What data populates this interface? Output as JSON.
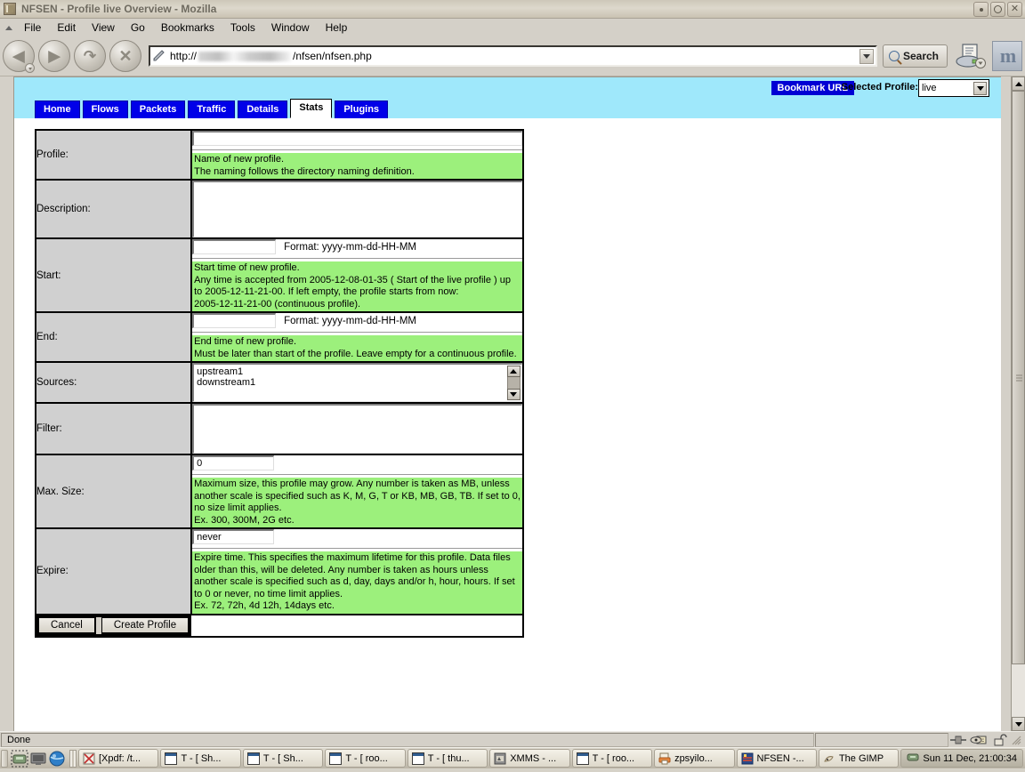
{
  "window": {
    "title": "NFSEN - Profile live Overview - Mozilla",
    "icon": "app-icon",
    "buttons": {
      "minimize": "·",
      "maximize": "○",
      "close": "×"
    }
  },
  "menubar": [
    {
      "label": "File"
    },
    {
      "label": "Edit"
    },
    {
      "label": "View"
    },
    {
      "label": "Go"
    },
    {
      "label": "Bookmarks"
    },
    {
      "label": "Tools"
    },
    {
      "label": "Window"
    },
    {
      "label": "Help"
    }
  ],
  "navbar": {
    "back": "◀",
    "forward": "▶",
    "reload": "↻",
    "stop": "✕",
    "url_prefix": "http://",
    "url_suffix": "/nfsen/nfsen.php",
    "search_label": "Search",
    "print_icon": "print-icon",
    "mozilla_icon": "m"
  },
  "nfsen": {
    "bookmark_label": "Bookmark URL",
    "selected_profile_label": "Selected Profile:",
    "selected_profile_value": "live",
    "banner_color": "#9fe8fb",
    "tab_color": "#0000e8",
    "tabs": [
      {
        "label": "Home",
        "active": false
      },
      {
        "label": "Flows",
        "active": false
      },
      {
        "label": "Packets",
        "active": false
      },
      {
        "label": "Traffic",
        "active": false
      },
      {
        "label": "Details",
        "active": false
      },
      {
        "label": "Stats",
        "active": true
      },
      {
        "label": "Plugins",
        "active": false
      }
    ]
  },
  "form": {
    "help_color": "#9cf07c",
    "profile": {
      "label": "Profile:",
      "value": "",
      "help": [
        "Name of new profile.",
        "The naming follows the directory naming definition."
      ]
    },
    "description": {
      "label": "Description:",
      "value": ""
    },
    "start": {
      "label": "Start:",
      "value": "",
      "format": "Format: yyyy-mm-dd-HH-MM",
      "help": [
        "Start time of new profile.",
        "Any time is accepted from 2005-12-08-01-35 ( Start of the live profile ) up",
        "to 2005-12-11-21-00. If left empty, the profile starts from now:",
        "2005-12-11-21-00 (continuous profile)."
      ]
    },
    "end": {
      "label": "End:",
      "value": "",
      "format": "Format: yyyy-mm-dd-HH-MM",
      "help": [
        "End time of new profile.",
        "Must be later than start of the profile. Leave empty for a continuous profile."
      ]
    },
    "sources": {
      "label": "Sources:",
      "options": [
        "upstream1",
        "downstream1"
      ]
    },
    "filter": {
      "label": "Filter:",
      "value": ""
    },
    "maxsize": {
      "label": "Max. Size:",
      "value": "0",
      "help": [
        "Maximum size, this profile may grow. Any number is taken as MB, unless",
        "another scale is specified such as K, M, G, T or KB, MB, GB, TB. If set to 0,",
        "no size limit applies.",
        "Ex. 300, 300M, 2G etc."
      ]
    },
    "expire": {
      "label": "Expire:",
      "value": "never",
      "help": [
        "Expire time. This specifies the maximum lifetime for this profile. Data files",
        "older than this, will be deleted. Any number is taken as hours unless",
        "another scale is specified such as d, day, days and/or h, hour, hours. If set",
        "to 0 or never, no time limit applies.",
        "Ex. 72, 72h, 4d 12h, 14days etc."
      ]
    },
    "cancel_label": "Cancel",
    "submit_label": "Create Profile"
  },
  "statusbar": {
    "text": "Done",
    "icons": [
      "network-activity-icon",
      "cookie-icon",
      "padlock-open-icon"
    ]
  },
  "taskbar": {
    "launchers": [
      "terminal-launcher-icon",
      "display-launcher-icon",
      "browser-launcher-icon"
    ],
    "items": [
      {
        "label": "[Xpdf: /t...",
        "icon": "xpdf-icon"
      },
      {
        "label": "T - [ Sh...",
        "icon": "terminal-icon"
      },
      {
        "label": "T - [ Sh...",
        "icon": "terminal-icon"
      },
      {
        "label": "T - [ roo...",
        "icon": "terminal-icon"
      },
      {
        "label": "T - [ thu...",
        "icon": "terminal-icon"
      },
      {
        "label": "XMMS - ...",
        "icon": "xmms-icon"
      },
      {
        "label": "T - [ roo...",
        "icon": "terminal-icon"
      },
      {
        "label": "zpsyilo...",
        "icon": "printer-icon"
      },
      {
        "label": "NFSEN -...",
        "icon": "mozilla-icon"
      },
      {
        "label": "The GIMP",
        "icon": "gimp-icon"
      }
    ],
    "clock": "Sun 11 Dec, 21:00:34"
  }
}
